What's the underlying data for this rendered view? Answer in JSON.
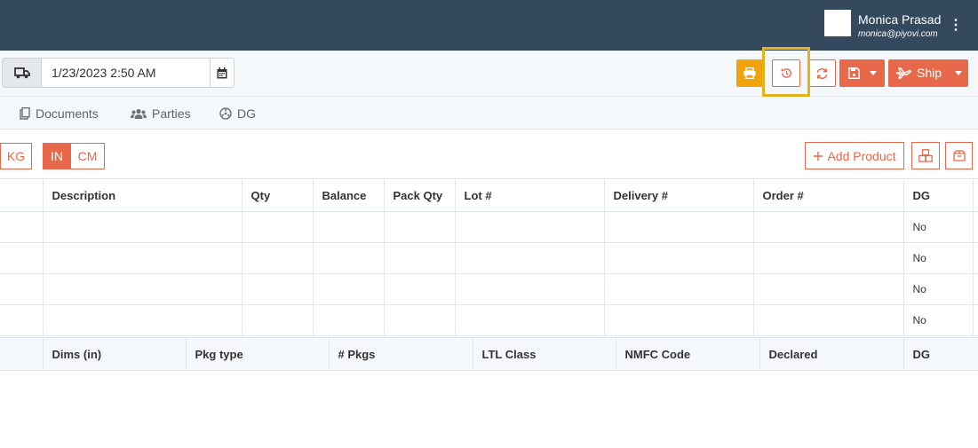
{
  "user": {
    "name": "Monica Prasad",
    "email": "monica@piyovi.com"
  },
  "toolbar": {
    "date_value": "1/23/2023 2:50 AM",
    "ship_label": "Ship",
    "accent_color": "#e7684a",
    "print_color": "#f0a30a",
    "highlight_color": "#e6b219"
  },
  "tabs": [
    {
      "label": "Documents",
      "icon": "document-icon"
    },
    {
      "label": "Parties",
      "icon": "users-icon"
    },
    {
      "label": "DG",
      "icon": "hazard-icon"
    }
  ],
  "units": {
    "kg": "KG",
    "in": "IN",
    "cm": "CM"
  },
  "add_product_label": "Add Product",
  "products_table": {
    "headers": [
      "Description",
      "Qty",
      "Balance",
      "Pack Qty",
      "Lot #",
      "Delivery #",
      "Order #",
      "DG"
    ],
    "rows": [
      [
        "",
        "",
        "",
        "",
        "",
        "",
        "",
        "No"
      ],
      [
        "",
        "",
        "",
        "",
        "",
        "",
        "",
        "No"
      ],
      [
        "",
        "",
        "",
        "",
        "",
        "",
        "",
        "No"
      ],
      [
        "",
        "",
        "",
        "",
        "",
        "",
        "",
        "No"
      ]
    ]
  },
  "packages_table": {
    "headers": [
      "Dims (in)",
      "Pkg type",
      "# Pkgs",
      "LTL Class",
      "NMFC Code",
      "Declared",
      "DG"
    ]
  }
}
